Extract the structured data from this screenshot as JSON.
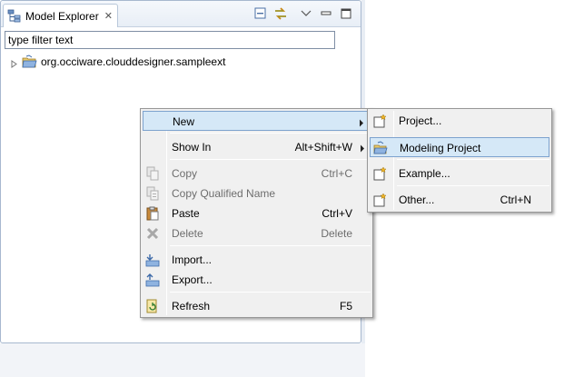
{
  "view": {
    "tab_title": "Model Explorer",
    "tab_icon": "model-explorer-icon",
    "toolbar_icons": [
      "collapse-all-icon",
      "link-with-editor-icon",
      "view-menu-icon",
      "minimize-icon",
      "maximize-icon"
    ]
  },
  "filter": {
    "value": "type filter text"
  },
  "tree": {
    "items": [
      {
        "label": "org.occiware.clouddesigner.sampleext",
        "icon": "project-folder-icon",
        "expanded": false
      }
    ]
  },
  "context_menu": {
    "items": [
      {
        "label": "New",
        "shortcut": "",
        "submenu": true,
        "enabled": true,
        "highlighted": true
      },
      {
        "label": "Show In",
        "shortcut": "Alt+Shift+W",
        "submenu": true,
        "enabled": true
      },
      {
        "label": "Copy",
        "shortcut": "Ctrl+C",
        "enabled": false,
        "icon": "copy-icon"
      },
      {
        "label": "Copy Qualified Name",
        "shortcut": "",
        "enabled": false,
        "icon": "copy-qualified-name-icon"
      },
      {
        "label": "Paste",
        "shortcut": "Ctrl+V",
        "enabled": true,
        "icon": "paste-icon"
      },
      {
        "label": "Delete",
        "shortcut": "Delete",
        "enabled": false,
        "icon": "delete-icon"
      },
      {
        "label": "Import...",
        "shortcut": "",
        "enabled": true,
        "icon": "import-icon"
      },
      {
        "label": "Export...",
        "shortcut": "",
        "enabled": true,
        "icon": "export-icon"
      },
      {
        "label": "Refresh",
        "shortcut": "F5",
        "enabled": true,
        "icon": "refresh-icon"
      }
    ]
  },
  "submenu": {
    "items": [
      {
        "label": "Project...",
        "shortcut": "",
        "icon": "new-project-icon"
      },
      {
        "label": "Modeling Project",
        "shortcut": "",
        "icon": "modeling-project-icon",
        "highlighted": true
      },
      {
        "label": "Example...",
        "shortcut": "",
        "icon": "new-example-icon"
      },
      {
        "label": "Other...",
        "shortcut": "Ctrl+N",
        "icon": "new-other-icon"
      }
    ]
  },
  "colors": {
    "highlight_bg": "#d5e8f7",
    "highlight_border": "#7da2ce",
    "menu_bg": "#f0f0f0",
    "disabled_text": "#6d6d6d"
  }
}
